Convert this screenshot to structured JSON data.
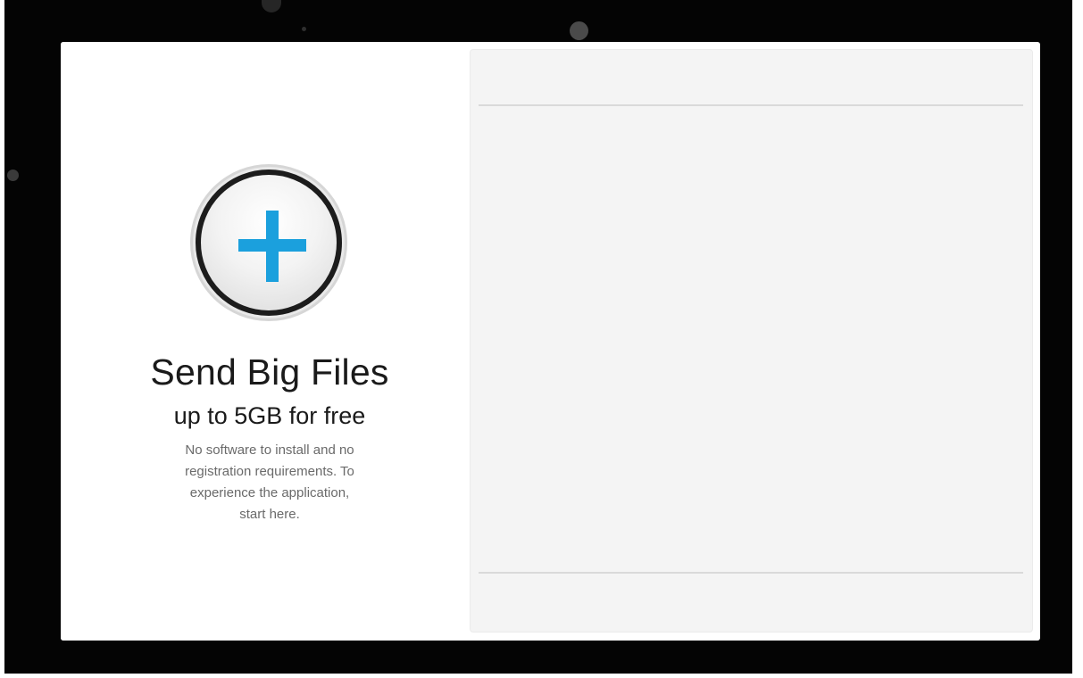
{
  "hero": {
    "add_button_icon": "plus-icon",
    "accent_color": "#1ba0dd",
    "title": "Send Big Files",
    "subtitle": "up to 5GB for free",
    "description_lines": [
      "No software to install and no",
      "registration requirements. To",
      "experience the application,",
      "start here."
    ]
  },
  "file_panel": {
    "header": "",
    "footer": ""
  }
}
